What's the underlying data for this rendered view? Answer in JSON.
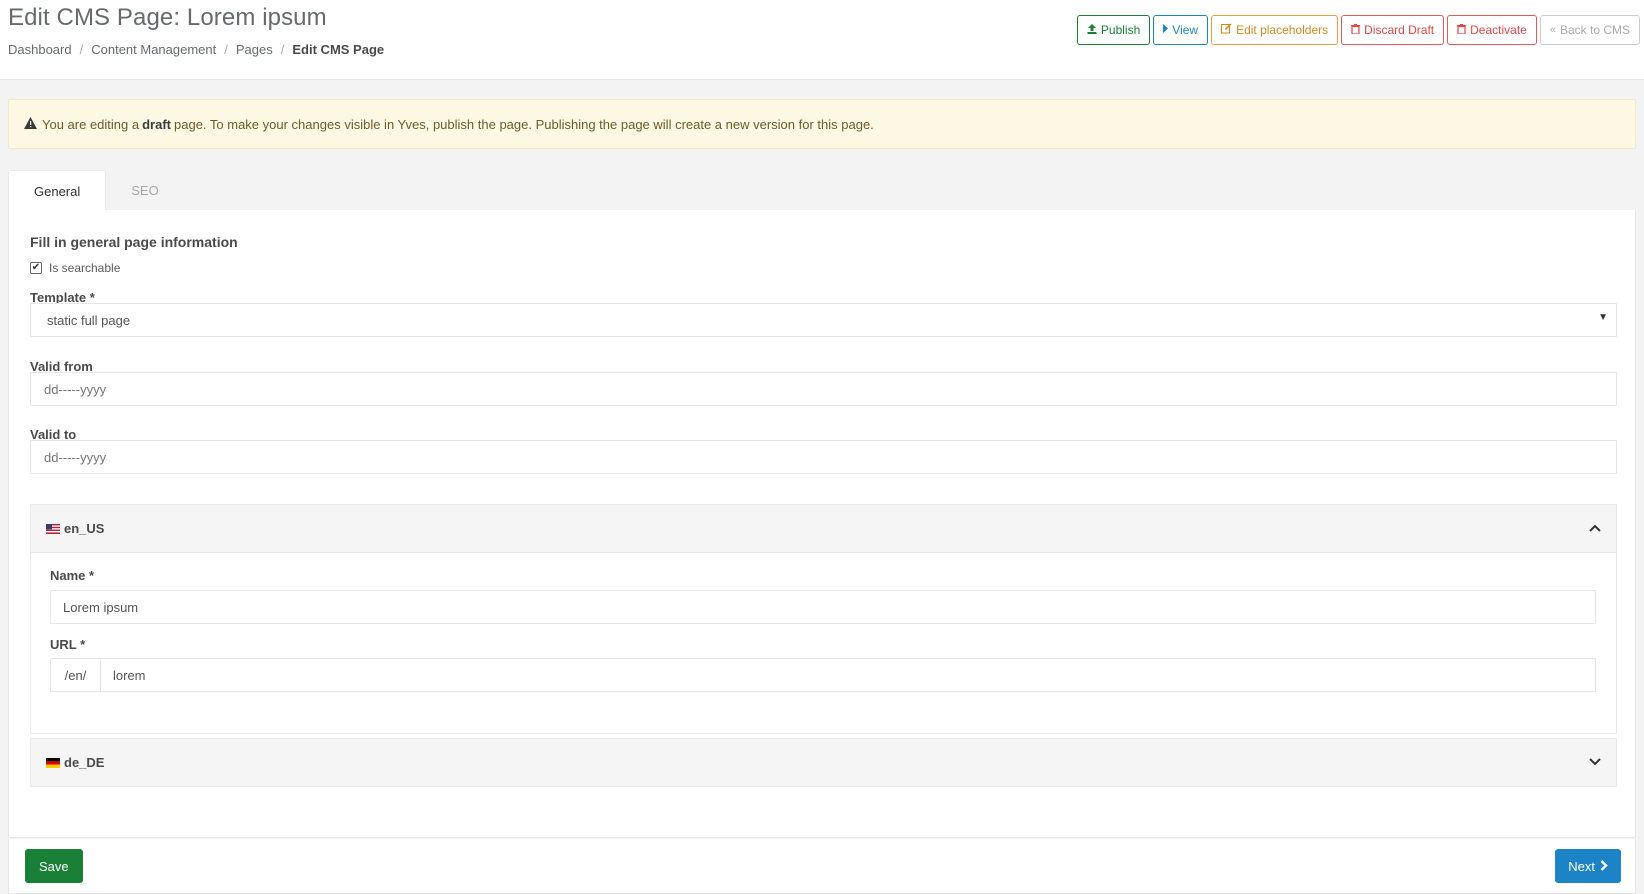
{
  "header": {
    "title": "Edit CMS Page: Lorem ipsum",
    "breadcrumbs": [
      "Dashboard",
      "Content Management",
      "Pages",
      "Edit CMS Page"
    ],
    "actions": {
      "publish": "Publish",
      "view": "View",
      "edit_placeholders": "Edit placeholders",
      "discard_draft": "Discard Draft",
      "deactivate": "Deactivate",
      "back_to_cms": "Back to CMS"
    }
  },
  "alert": {
    "prefix": "You are editing a",
    "bold": "draft",
    "suffix": "page. To make your changes visible in Yves, publish the page. Publishing the page will create a new version for this page."
  },
  "tabs": [
    {
      "label": "General",
      "active": true
    },
    {
      "label": "SEO",
      "active": false
    }
  ],
  "form": {
    "heading": "Fill in general page information",
    "is_searchable_label": "Is searchable",
    "is_searchable_checked": true,
    "template_label": "Template *",
    "template_value": "static full page",
    "valid_from_label": "Valid from",
    "valid_from_value": "dd-----yyyy",
    "valid_to_label": "Valid to",
    "valid_to_value": "dd-----yyyy"
  },
  "locales": [
    {
      "code": "en_US",
      "expanded": true,
      "name_label": "Name *",
      "name_value": "Lorem ipsum",
      "url_label": "URL *",
      "url_prefix": "/en/",
      "url_value": "lorem"
    },
    {
      "code": "de_DE",
      "expanded": false
    }
  ],
  "footer": {
    "save_label": "Save",
    "next_label": "Next"
  },
  "colors": {
    "success": "#1a7f37",
    "primary": "#1c84c6",
    "warning": "#d18a1f",
    "danger": "#e04848",
    "alert_bg": "#fcf8e3"
  }
}
